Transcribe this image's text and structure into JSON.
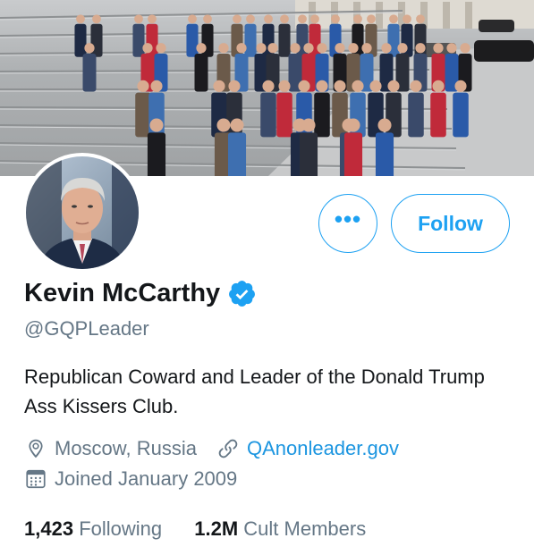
{
  "profile": {
    "name": "Kevin McCarthy",
    "handle": "@GQPLeader",
    "bio": "Republican Coward and Leader of the Donald Trump Ass Kissers Club.",
    "location": "Moscow, Russia",
    "website": "QAnonleader.gov",
    "joined": "Joined January 2009"
  },
  "actions": {
    "more_label": "•••",
    "follow_label": "Follow"
  },
  "stats": {
    "following_count": "1,423",
    "following_label": "Following",
    "followers_count": "1.2M",
    "followers_label": "Cult Members"
  },
  "icons": {
    "verified": "verified-badge-icon",
    "location": "location-pin-icon",
    "link": "link-icon",
    "calendar": "calendar-icon"
  },
  "colors": {
    "accent": "#1da1f2",
    "link": "#1b95e0",
    "text": "#14171a",
    "muted": "#657786"
  }
}
